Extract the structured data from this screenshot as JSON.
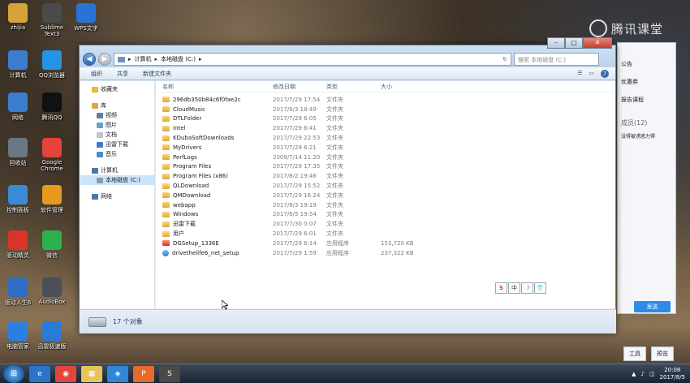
{
  "watermark": {
    "text": "腾讯课堂"
  },
  "desktop_icons": [
    {
      "label": "zhijia",
      "icon": "folder-icon",
      "color": "#d6a33a"
    },
    {
      "label": "Sublime Text3",
      "icon": "sublime-icon",
      "color": "#4a4a4a"
    },
    {
      "label": "WPS文字",
      "icon": "wps-icon",
      "color": "#2a72d6"
    },
    {
      "label": "计算机",
      "icon": "computer-icon",
      "color": "#3b7ccf"
    },
    {
      "label": "QQ浏览器",
      "icon": "qq-browser-icon",
      "color": "#2494e6"
    },
    {
      "label": "网络",
      "icon": "network-icon",
      "color": "#3b7ccf"
    },
    {
      "label": "腾讯QQ",
      "icon": "qq-icon",
      "color": "#111111"
    },
    {
      "label": "回收站",
      "icon": "recycle-bin-icon",
      "color": "#6a7785"
    },
    {
      "label": "Google Chrome",
      "icon": "chrome-icon",
      "color": "#e5443a"
    },
    {
      "label": "控制面板",
      "icon": "control-panel-icon",
      "color": "#3a8bd5"
    },
    {
      "label": "软件管理",
      "icon": "software-manager-icon",
      "color": "#e59a1f"
    },
    {
      "label": "驱动精灵",
      "icon": "driver-icon",
      "color": "#d9342b"
    },
    {
      "label": "微信",
      "icon": "wechat-icon",
      "color": "#2bb24c"
    },
    {
      "label": "驱动人生6",
      "icon": "gear-icon",
      "color": "#2f6dc2"
    },
    {
      "label": "AudioBox",
      "icon": "audiobox-icon",
      "color": "#4a4f58"
    },
    {
      "label": "电脑管家",
      "icon": "shield-icon",
      "color": "#2b7fe0"
    },
    {
      "label": "迅雷极速版",
      "icon": "thunder-icon",
      "color": "#2a7ad8"
    }
  ],
  "right_panel": {
    "items": [
      "公告",
      "优惠券",
      "报告课程",
      "成员(12)",
      "没得被诱惑力得"
    ],
    "send": "发送",
    "tools": "工具",
    "preview": "预览"
  },
  "explorer": {
    "breadcrumb": [
      "计算机",
      "本地磁盘 (C:)"
    ],
    "search_placeholder": "搜索 本地磁盘 (C:)",
    "toolbar": {
      "organize": "组织",
      "share": "共享",
      "new_folder": "新建文件夹"
    },
    "sidebar": {
      "favorites": "收藏夹",
      "libraries": "库",
      "videos": "视频",
      "pictures": "图片",
      "docs": "文档",
      "thunder": "迅雷下载",
      "music": "音乐",
      "computer": "计算机",
      "local_disk": "本地磁盘 (C:)",
      "network": "网络"
    },
    "columns": {
      "name": "名称",
      "date": "修改日期",
      "type": "类型",
      "size": "大小"
    },
    "rows": [
      {
        "name": "296db350b84c6f0fae2c",
        "date": "2017/7/29 17:54",
        "type": "文件夹",
        "size": "",
        "kind": "folder"
      },
      {
        "name": "CloudMusic",
        "date": "2017/8/3 18:49",
        "type": "文件夹",
        "size": "",
        "kind": "folder"
      },
      {
        "name": "DTLFolder",
        "date": "2017/7/29 6:05",
        "type": "文件夹",
        "size": "",
        "kind": "folder"
      },
      {
        "name": "Intel",
        "date": "2017/7/29 6:41",
        "type": "文件夹",
        "size": "",
        "kind": "folder"
      },
      {
        "name": "KDubaSoftDownloads",
        "date": "2017/7/29 22:53",
        "type": "文件夹",
        "size": "",
        "kind": "folder"
      },
      {
        "name": "MyDrivers",
        "date": "2017/7/29 6:21",
        "type": "文件夹",
        "size": "",
        "kind": "folder"
      },
      {
        "name": "PerfLogs",
        "date": "2009/7/14 11:20",
        "type": "文件夹",
        "size": "",
        "kind": "folder"
      },
      {
        "name": "Program Files",
        "date": "2017/7/29 17:35",
        "type": "文件夹",
        "size": "",
        "kind": "folder"
      },
      {
        "name": "Program Files (x86)",
        "date": "2017/8/2 19:46",
        "type": "文件夹",
        "size": "",
        "kind": "folder"
      },
      {
        "name": "QLDownload",
        "date": "2017/7/29 15:52",
        "type": "文件夹",
        "size": "",
        "kind": "folder"
      },
      {
        "name": "QMDownload",
        "date": "2017/7/29 16:24",
        "type": "文件夹",
        "size": "",
        "kind": "folder"
      },
      {
        "name": "webapp",
        "date": "2017/8/3 19:19",
        "type": "文件夹",
        "size": "",
        "kind": "folder"
      },
      {
        "name": "Windows",
        "date": "2017/8/5 19:54",
        "type": "文件夹",
        "size": "",
        "kind": "folder"
      },
      {
        "name": "迅雷下载",
        "date": "2017/7/30 0:07",
        "type": "文件夹",
        "size": "",
        "kind": "folder"
      },
      {
        "name": "用户",
        "date": "2017/7/29 6:01",
        "type": "文件夹",
        "size": "",
        "kind": "folder"
      },
      {
        "name": "DGSetup_1336E",
        "date": "2017/7/29 6:14",
        "type": "应用程序",
        "size": "153,720 KB",
        "kind": "app"
      },
      {
        "name": "drivethelife6_net_setup",
        "date": "2017/7/29 1:59",
        "type": "应用程序",
        "size": "237,322 KB",
        "kind": "app2"
      }
    ],
    "ime": [
      "S",
      "中",
      "☽",
      "👕"
    ],
    "status": "17 个对象"
  },
  "taskbar": {
    "time": "20:08",
    "date": "2017/8/5",
    "apps": [
      {
        "icon": "ie-icon",
        "color": "#2a73c9",
        "glyph": "e"
      },
      {
        "icon": "chrome-icon",
        "color": "#e5443a",
        "glyph": "◉"
      },
      {
        "icon": "file-explorer-icon",
        "color": "#e8c35a",
        "glyph": "▦"
      },
      {
        "icon": "package-icon",
        "color": "#2f86d6",
        "glyph": "◈"
      },
      {
        "icon": "app-icon",
        "color": "#e86a2a",
        "glyph": "P"
      },
      {
        "icon": "sublime-icon",
        "color": "#4a4a4a",
        "glyph": "S"
      }
    ]
  }
}
